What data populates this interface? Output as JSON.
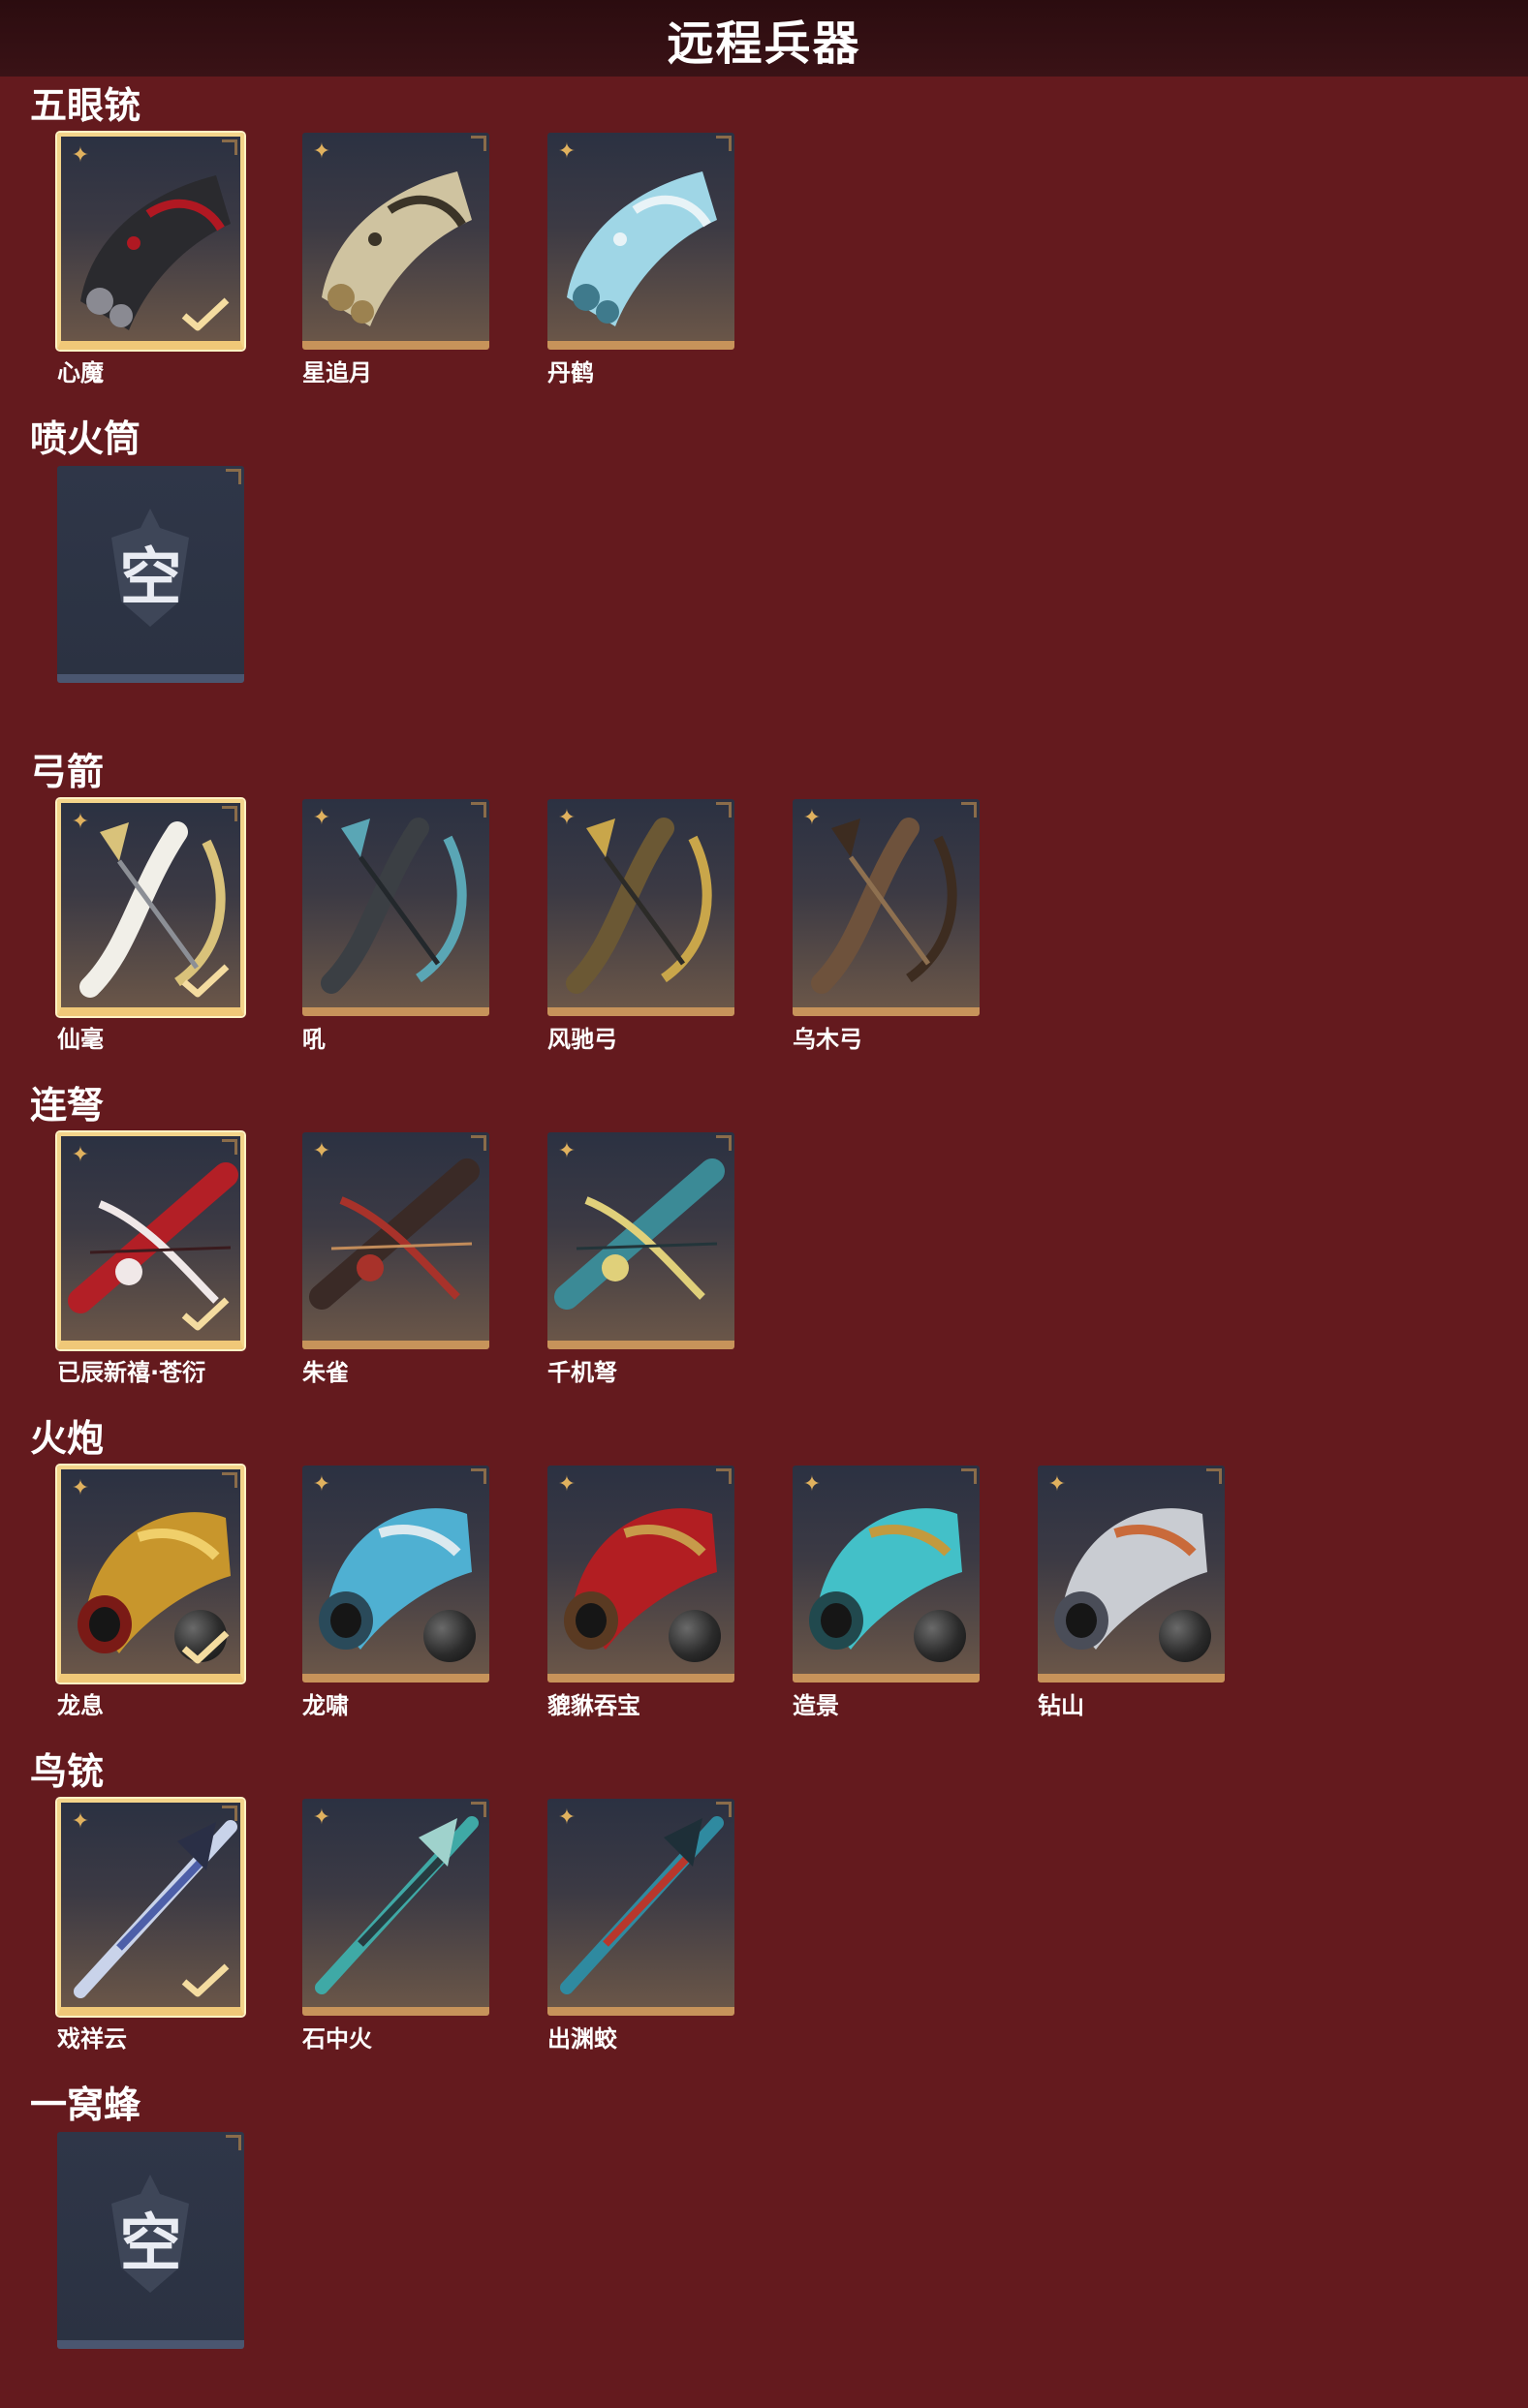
{
  "header": {
    "title": "远程兵器"
  },
  "sections": [
    {
      "title": "五眼铳",
      "items": [
        {
          "name": "心魔",
          "selected": true,
          "art": "dragon-gun-red"
        },
        {
          "name": "星追月",
          "selected": false,
          "art": "multi-barrel-gold"
        },
        {
          "name": "丹鹤",
          "selected": false,
          "art": "crane-gun-blue"
        }
      ]
    },
    {
      "title": "喷火筒",
      "items": [
        {
          "name": "",
          "empty": true,
          "empty_label": "空"
        }
      ]
    },
    {
      "title": "弓箭",
      "items": [
        {
          "name": "仙毫",
          "selected": true,
          "art": "bow-white"
        },
        {
          "name": "吼",
          "selected": false,
          "art": "bow-dark-teal"
        },
        {
          "name": "风驰弓",
          "selected": false,
          "art": "bow-gold"
        },
        {
          "name": "乌木弓",
          "selected": false,
          "art": "bow-wood"
        }
      ]
    },
    {
      "title": "连弩",
      "items": [
        {
          "name": "已辰新禧·苍衍",
          "selected": true,
          "art": "crossbow-red"
        },
        {
          "name": "朱雀",
          "selected": false,
          "art": "crossbow-dark"
        },
        {
          "name": "千机弩",
          "selected": false,
          "art": "crossbow-teal"
        }
      ]
    },
    {
      "title": "火炮",
      "items": [
        {
          "name": "龙息",
          "selected": true,
          "art": "cannon-gold-dragon"
        },
        {
          "name": "龙啸",
          "selected": false,
          "art": "cannon-blue-dragon"
        },
        {
          "name": "貔貅吞宝",
          "selected": false,
          "art": "cannon-red"
        },
        {
          "name": "造景",
          "selected": false,
          "art": "cannon-teal"
        },
        {
          "name": "钻山",
          "selected": false,
          "art": "cannon-silver"
        }
      ]
    },
    {
      "title": "鸟铳",
      "items": [
        {
          "name": "戏祥云",
          "selected": true,
          "art": "rifle-blue"
        },
        {
          "name": "石中火",
          "selected": false,
          "art": "rifle-teal"
        },
        {
          "name": "出渊蛟",
          "selected": false,
          "art": "rifle-red-teal"
        }
      ]
    },
    {
      "title": "一窝蜂",
      "items": [
        {
          "name": "",
          "empty": true,
          "empty_label": "空"
        }
      ]
    }
  ],
  "colors": {
    "background": "#641a1e",
    "header": "#2b0c0f",
    "frame_gold": "#c7935a",
    "selected_border": "#f3d48a",
    "star": "#e0b15e"
  }
}
